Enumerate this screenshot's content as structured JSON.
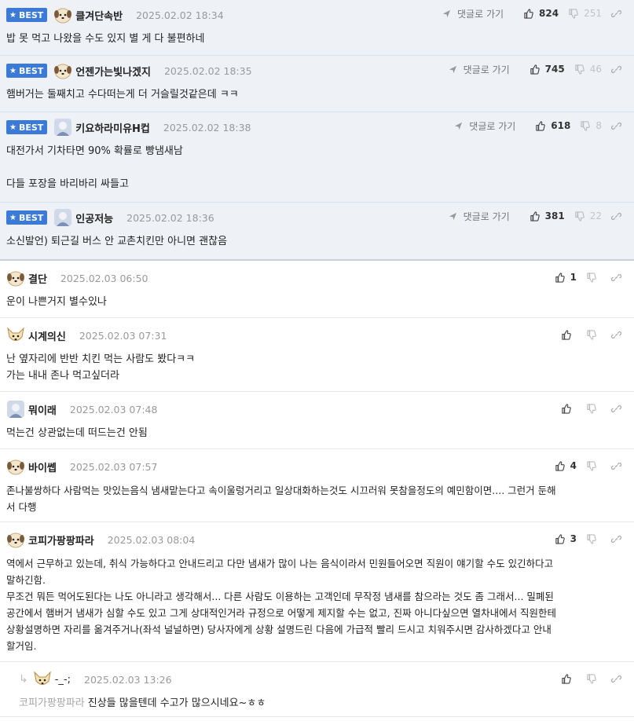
{
  "labels": {
    "best": "BEST",
    "goto_comment": "댓글로 가기"
  },
  "colors": {
    "best_badge": "#3b7bd7",
    "best_bg": "#eef1f6"
  },
  "best_comments": [
    {
      "nick": "클겨단속반",
      "date": "2025.02.02 18:34",
      "likes": "824",
      "hates": "251",
      "avatar": "puppy-icon",
      "text": "밥 못 먹고 나왔을 수도 있지 별 게 다 불편하네"
    },
    {
      "nick": "언젠가는빛나겠지",
      "date": "2025.02.02 18:35",
      "likes": "745",
      "hates": "46",
      "avatar": "puppy-icon",
      "text": "햄버거는 둘째치고 수다떠는게 더 거슬릴것같은데 ㅋㅋ"
    },
    {
      "nick": "키요하라미유H컵",
      "date": "2025.02.02 18:38",
      "likes": "618",
      "hates": "8",
      "avatar": "photo-avatar-icon",
      "text": "대전가서 기차타면 90% 확률로 빵냄새남\n\n다들 포장을 바리바리 싸들고"
    },
    {
      "nick": "인공저능",
      "date": "2025.02.02 18:36",
      "likes": "381",
      "hates": "22",
      "avatar": "photo-avatar-icon",
      "text": "소신발언) 퇴근길 버스 안 교촌치킨만 아니면 괜찮음"
    }
  ],
  "comments": [
    {
      "nick": "결단",
      "date": "2025.02.03 06:50",
      "likes": "1",
      "avatar": "puppy-icon",
      "text": "운이 나쁜거지 별수있나"
    },
    {
      "nick": "시계의신",
      "date": "2025.02.03 07:31",
      "likes": "",
      "avatar": "fox-icon",
      "text": "난 옆자리에 반반 치킨 먹는 사람도 봤다ㅋㅋ\n가는 내내 존나 먹고싶더라"
    },
    {
      "nick": "뭐이래",
      "date": "2025.02.03 07:48",
      "likes": "",
      "avatar": "photo-avatar-icon",
      "text": "먹는건 상관없는데 떠드는건 안됨"
    },
    {
      "nick": "바이쎕",
      "date": "2025.02.03 07:57",
      "likes": "4",
      "avatar": "puppy-icon",
      "text": "존나불쌍하다 사람먹는 맛있는음식 냄새맡는다고 속이울렁거리고 일상대화하는것도 시끄러워 못참을정도의 예민함이면.... 그런거 둔해\n서 다행"
    },
    {
      "nick": "코피가팡팡파라",
      "date": "2025.02.03 08:04",
      "likes": "3",
      "avatar": "puppy-icon",
      "text": "역에서 근무하고 있는데, 취식 가능하다고 안내드리고 다만 냄새가 많이 나는 음식이라서 민원들어오면 직원이 얘기할 수도 있긴하다고\n말하긴함.\n무조건 뭐든 먹어도된다는 나도 아니라고 생각해서... 다른 사람도 이용하는 고객인데 무작정 냄새를 참으라는 것도 좀 그래서... 밀폐된\n공간에서 햄버거 냄새가 심할 수도 있고 그게 상대적인거라 규정으로 어떻게 제지할 수는 없고, 진짜 아니다싶으면 열차내에서 직원한테\n상황설명하면 자리를 옮겨주거나(좌석 널널하면) 당사자에게 상황 설명드린 다음에 가급적 빨리 드시고 치워주시면 감사하겠다고 안내\n할거임."
    }
  ],
  "reply": {
    "nick": "-_-;",
    "date": "2025.02.03 13:26",
    "likes": "",
    "avatar": "fox-icon",
    "mention": "코피가팡팡파라",
    "text": "진상들 많을텐데 수고가 많으시네요~ㅎㅎ"
  }
}
